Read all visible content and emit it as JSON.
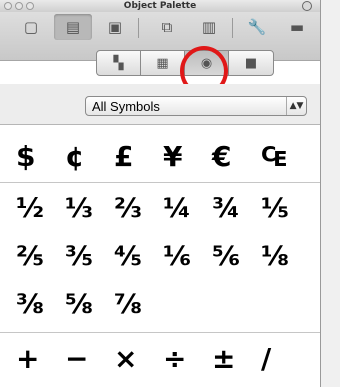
{
  "window": {
    "title": "Object Palette"
  },
  "toolbar": {
    "buttons": [
      {
        "name": "text-tool-icon",
        "glyph": "▢"
      },
      {
        "name": "graphic-tool-icon",
        "glyph": "▤"
      },
      {
        "name": "copy-tool-icon",
        "glyph": "▣"
      },
      {
        "name": "frame-tool-icon",
        "glyph": "⧉"
      },
      {
        "name": "chart-tool-icon",
        "glyph": "▥"
      },
      {
        "name": "wrench-icon",
        "glyph": "🔧"
      },
      {
        "name": "briefcase-icon",
        "glyph": "▬"
      }
    ]
  },
  "segments": [
    {
      "name": "seg-cell-copy",
      "glyph": "▚"
    },
    {
      "name": "seg-cell-grid",
      "glyph": "▦"
    },
    {
      "name": "seg-cell-symbols",
      "glyph": "◉"
    },
    {
      "name": "seg-cell-image",
      "glyph": "■"
    }
  ],
  "dropdown": {
    "label": "All Symbols"
  },
  "symbols": {
    "rows": [
      [
        "$",
        "¢",
        "£",
        "¥",
        "€",
        "₠"
      ],
      [
        "½",
        "⅓",
        "⅔",
        "¼",
        "¾",
        "⅕"
      ],
      [
        "⅖",
        "⅗",
        "⅘",
        "⅙",
        "⅚",
        "⅛"
      ],
      [
        "⅜",
        "⅝",
        "⅞"
      ],
      [
        "+",
        "−",
        "×",
        "÷",
        "±",
        "/"
      ]
    ]
  },
  "colors": {
    "highlight": "#e01818",
    "toolbar": "#d2d2d2"
  }
}
